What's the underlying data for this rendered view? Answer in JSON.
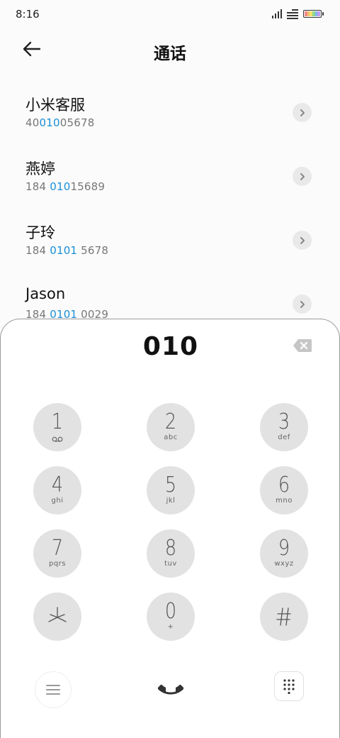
{
  "status_bar": {
    "time": "8:16",
    "icons": [
      "signal-icon",
      "wifi-icon",
      "battery-icon"
    ]
  },
  "header": {
    "title": "通话",
    "back_icon": "back-arrow-icon"
  },
  "contacts": [
    {
      "name": "小米客服",
      "number_parts": [
        [
          "40",
          false
        ],
        [
          "010",
          true
        ],
        [
          "05678",
          false
        ]
      ]
    },
    {
      "name": "燕婷",
      "number_parts": [
        [
          "184 ",
          false
        ],
        [
          "010",
          true
        ],
        [
          "15689",
          false
        ]
      ]
    },
    {
      "name": "子玲",
      "number_parts": [
        [
          "184 ",
          false
        ],
        [
          "0101",
          true
        ],
        [
          " 5678",
          false
        ]
      ]
    },
    {
      "name": "Jason",
      "number_parts": [
        [
          "184 ",
          false
        ],
        [
          "0101",
          true
        ],
        [
          " 0029",
          false
        ]
      ]
    }
  ],
  "dialer": {
    "input": "010",
    "keys": [
      {
        "digit": "1",
        "letters": "",
        "icon": "voicemail-icon"
      },
      {
        "digit": "2",
        "letters": "abc"
      },
      {
        "digit": "3",
        "letters": "def"
      },
      {
        "digit": "4",
        "letters": "ghi"
      },
      {
        "digit": "5",
        "letters": "jkl"
      },
      {
        "digit": "6",
        "letters": "mno"
      },
      {
        "digit": "7",
        "letters": "pqrs"
      },
      {
        "digit": "8",
        "letters": "tuv"
      },
      {
        "digit": "9",
        "letters": "wxyz"
      },
      {
        "digit": "*",
        "letters": ""
      },
      {
        "digit": "0",
        "letters": "+"
      },
      {
        "digit": "#",
        "letters": ""
      }
    ]
  },
  "bottom_bar": {
    "icons": [
      "menu-icon",
      "phone-icon",
      "keypad-icon"
    ]
  },
  "colors": {
    "highlight": "#1a8fd8",
    "key_bg": "#e2e2e2",
    "battery_segments": [
      "#f28b8b",
      "#f5c16c",
      "#f3e36b",
      "#8fd68f",
      "#7fb8f0",
      "#c49cf0"
    ]
  }
}
